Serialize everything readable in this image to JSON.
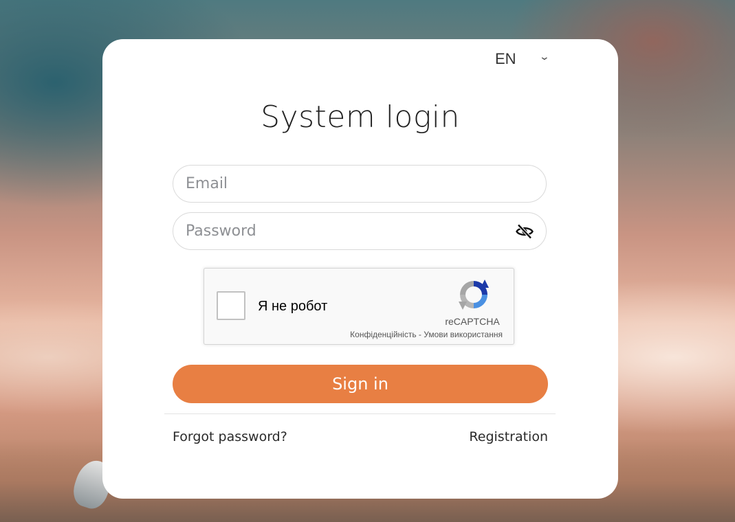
{
  "language": {
    "selected": "EN"
  },
  "login": {
    "title": "System login",
    "email_placeholder": "Email",
    "password_placeholder": "Password",
    "signin_label": "Sign in",
    "forgot_label": "Forgot password?",
    "register_label": "Registration"
  },
  "captcha": {
    "checkbox_label": "Я не робот",
    "brand": "reCAPTCHA",
    "privacy_link": "Конфіденційність",
    "separator": " - ",
    "terms_link": "Умови використання"
  },
  "colors": {
    "accent": "#e87f43",
    "title_text": "#222222",
    "placeholder": "#8e9094"
  },
  "icons": {
    "password_toggle": "eye-slash-icon",
    "language_dropdown": "chevron-down-icon",
    "captcha_logo": "recaptcha-logo-icon"
  }
}
